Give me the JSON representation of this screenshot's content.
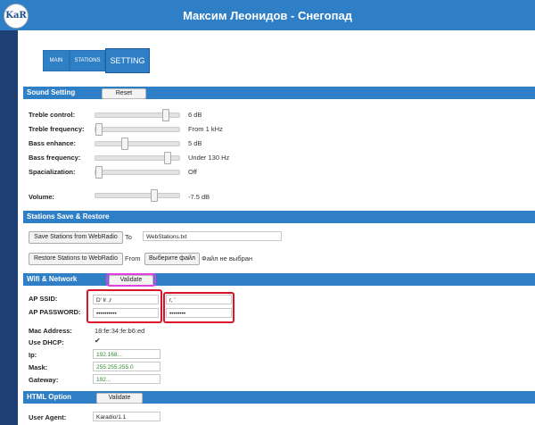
{
  "header": {
    "title": "Максим Леонидов - Снегопад",
    "logo": "KaR"
  },
  "tabs": [
    {
      "label": "MAIN"
    },
    {
      "label": "STATIONS"
    },
    {
      "label": "SETTING"
    }
  ],
  "sound": {
    "section_title": "Sound Setting",
    "reset_label": "Reset",
    "rows": [
      {
        "label": "Treble control:",
        "value": "6 dB",
        "level": 0.85
      },
      {
        "label": "Treble frequency:",
        "value": "From 1 kHz",
        "level": 0.0
      },
      {
        "label": "Bass enhance:",
        "value": "5 dB",
        "level": 0.33
      },
      {
        "label": "Bass frequency:",
        "value": "Under 130 Hz",
        "level": 0.88
      },
      {
        "label": "Spacialization:",
        "value": "Off",
        "level": 0.0
      },
      {
        "label": "Volume:",
        "value": "-7.5 dB",
        "level": 0.7
      }
    ]
  },
  "stations": {
    "section_title": "Stations Save & Restore",
    "save_label": "Save Stations from WebRadio",
    "to_label": "To",
    "save_file": "WebStations.txt",
    "restore_label": "Restore Stations to WebRadio",
    "from_label": "From",
    "choose_label": "Выберите файл",
    "no_file_label": "Файл не выбран"
  },
  "wifi": {
    "section_title": "Wifi & Network",
    "validate_label": "Validate",
    "ssid_label": "AP SSID:",
    "ssid_value": "D' lr ,r",
    "ssid2_value": "r, '",
    "password_label": "AP PASSWORD:",
    "password_value": "••••••••••",
    "password2_value": "••••••••",
    "mac_label": "Mac Address:",
    "mac_value": "18:fe:34:fe:b6:ed",
    "dhcp_label": "Use DHCP:",
    "dhcp_checked": "✔",
    "ip_label": "Ip:",
    "ip_value": "192.168...",
    "mask_label": "Mask:",
    "mask_value": "255.255.255.0",
    "gateway_label": "Gateway:",
    "gateway_value": "192..."
  },
  "html_option": {
    "section_title": "HTML Option",
    "validate_label": "Validate",
    "agent_label": "User Agent:",
    "agent_value": "Karadio/1.1"
  },
  "colors": {
    "accent": "#2f7fc6",
    "sidebar": "#1d3f73",
    "highlight_red": "#d9142b",
    "highlight_magenta": "#e040e0",
    "ip_green": "#2e8b2e"
  }
}
